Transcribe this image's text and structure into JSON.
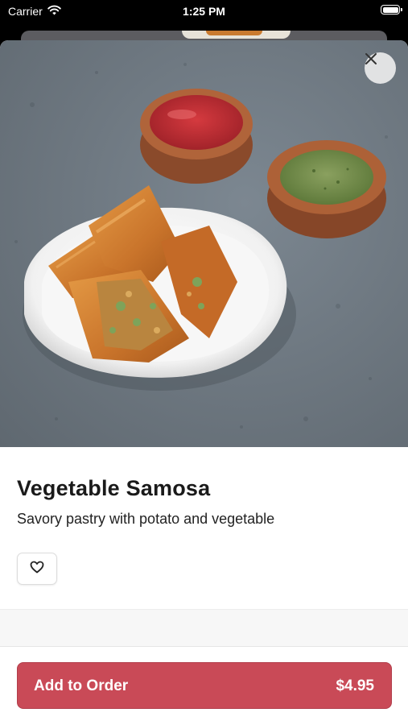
{
  "status_bar": {
    "carrier": "Carrier",
    "time": "1:25 PM",
    "wifi_icon": "wifi-icon",
    "battery_icon": "battery-icon"
  },
  "item": {
    "name": "Vegetable Samosa",
    "description": "Savory pastry with potato and vegetable",
    "image_alt": "Vegetable samosa on a white plate with red and green chutneys"
  },
  "actions": {
    "close_icon": "close-icon",
    "favorite_icon": "heart-icon",
    "add_to_order_label": "Add to Order",
    "price": "$4.95"
  },
  "colors": {
    "accent": "#c94a57",
    "background": "#ffffff",
    "status_bar": "#000000"
  }
}
